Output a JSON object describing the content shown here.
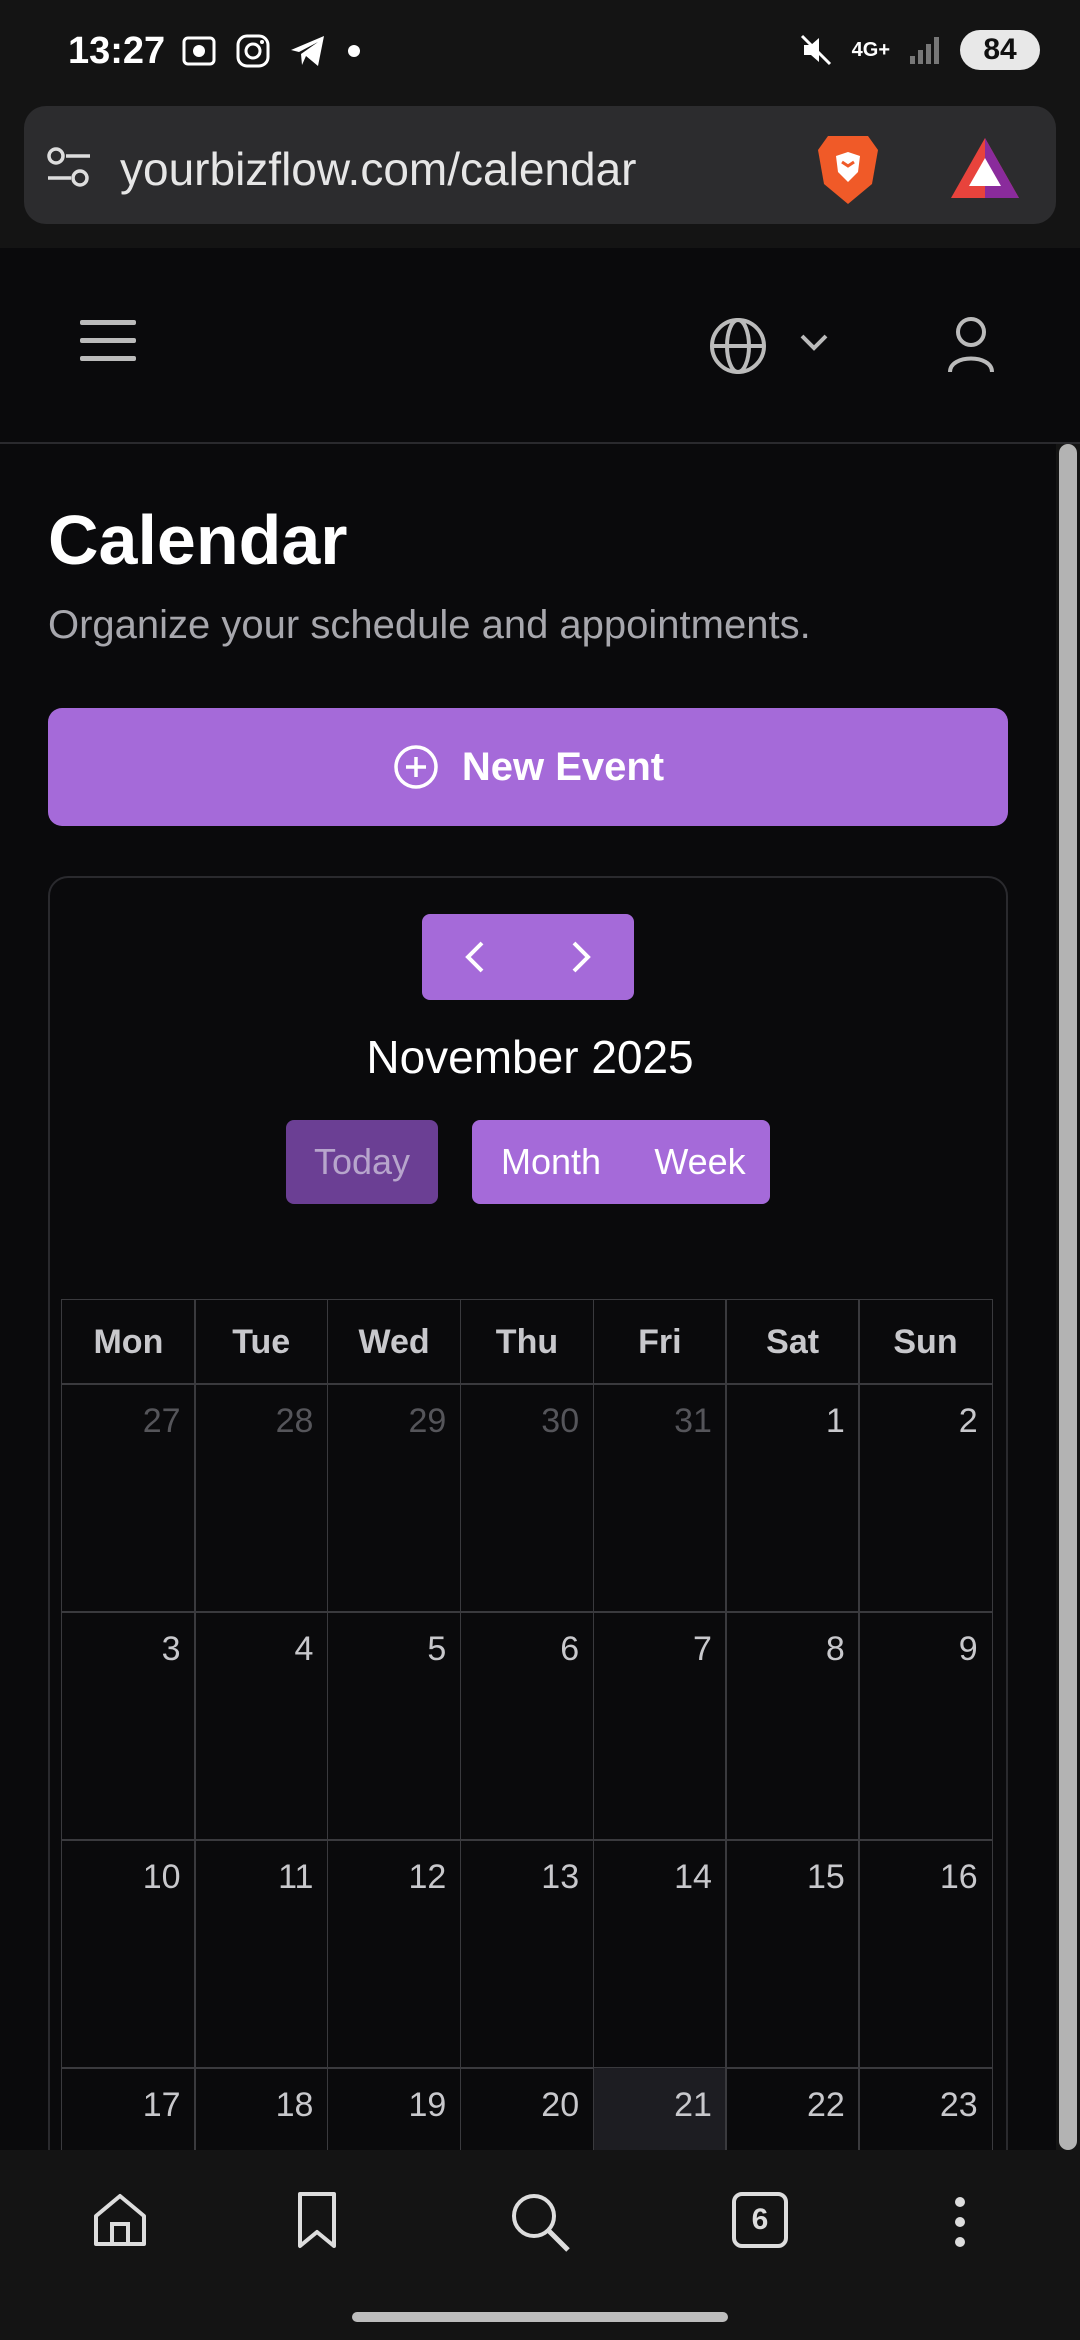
{
  "status_bar": {
    "time": "13:27",
    "network": "4G+",
    "battery": "84"
  },
  "browser": {
    "url": "yourbizflow.com/calendar"
  },
  "page": {
    "title": "Calendar",
    "subtitle": "Organize your schedule and appointments.",
    "new_event_label": "New Event"
  },
  "calendar": {
    "month_label": "November 2025",
    "today_label": "Today",
    "month_label_btn": "Month",
    "week_label_btn": "Week",
    "weekdays": [
      "Mon",
      "Tue",
      "Wed",
      "Thu",
      "Fri",
      "Sat",
      "Sun"
    ],
    "weeks": [
      [
        "27",
        "28",
        "29",
        "30",
        "31",
        "1",
        "2"
      ],
      [
        "3",
        "4",
        "5",
        "6",
        "7",
        "8",
        "9"
      ],
      [
        "10",
        "11",
        "12",
        "13",
        "14",
        "15",
        "16"
      ],
      [
        "17",
        "18",
        "19",
        "20",
        "21",
        "22",
        "23"
      ]
    ]
  },
  "bottom_nav": {
    "tab_count": "6"
  },
  "colors": {
    "accent": "#a56ad9",
    "accent_dark": "#6b3f94",
    "background": "#0a0a0c"
  }
}
